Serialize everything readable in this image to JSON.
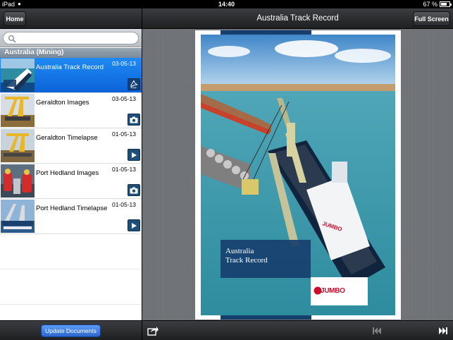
{
  "status_bar": {
    "carrier": "iPad",
    "time": "14:40",
    "battery": "67 %"
  },
  "left_nav": {
    "home_label": "Home"
  },
  "search": {
    "placeholder": ""
  },
  "section": {
    "title": "Australia (Mining)"
  },
  "documents": [
    {
      "title": "Australia Track Record",
      "date": "03-05-13",
      "type_icon": "pdf-icon",
      "selected": true
    },
    {
      "title": "Geraldton Images",
      "date": "03-05-13",
      "type_icon": "camera-icon",
      "selected": false
    },
    {
      "title": "Geraldton Timelapse",
      "date": "01-05-13",
      "type_icon": "play-icon",
      "selected": false
    },
    {
      "title": "Port Hedland Images",
      "date": "01-05-13",
      "type_icon": "camera-icon",
      "selected": false
    },
    {
      "title": "Port Hedland Timelapse",
      "date": "01-05-13",
      "type_icon": "play-icon",
      "selected": false
    }
  ],
  "left_toolbar": {
    "update_label": "Update Documents"
  },
  "viewer": {
    "title": "Australia Track Record",
    "fullscreen_label": "Full Screen",
    "cover_title_line1": "Australia",
    "cover_title_line2": "Track Record",
    "brand": "JUMBO"
  },
  "colors": {
    "selected_row": "#0b63d9",
    "cover_blue": "#173f6e",
    "brand_red": "#c8102e"
  }
}
